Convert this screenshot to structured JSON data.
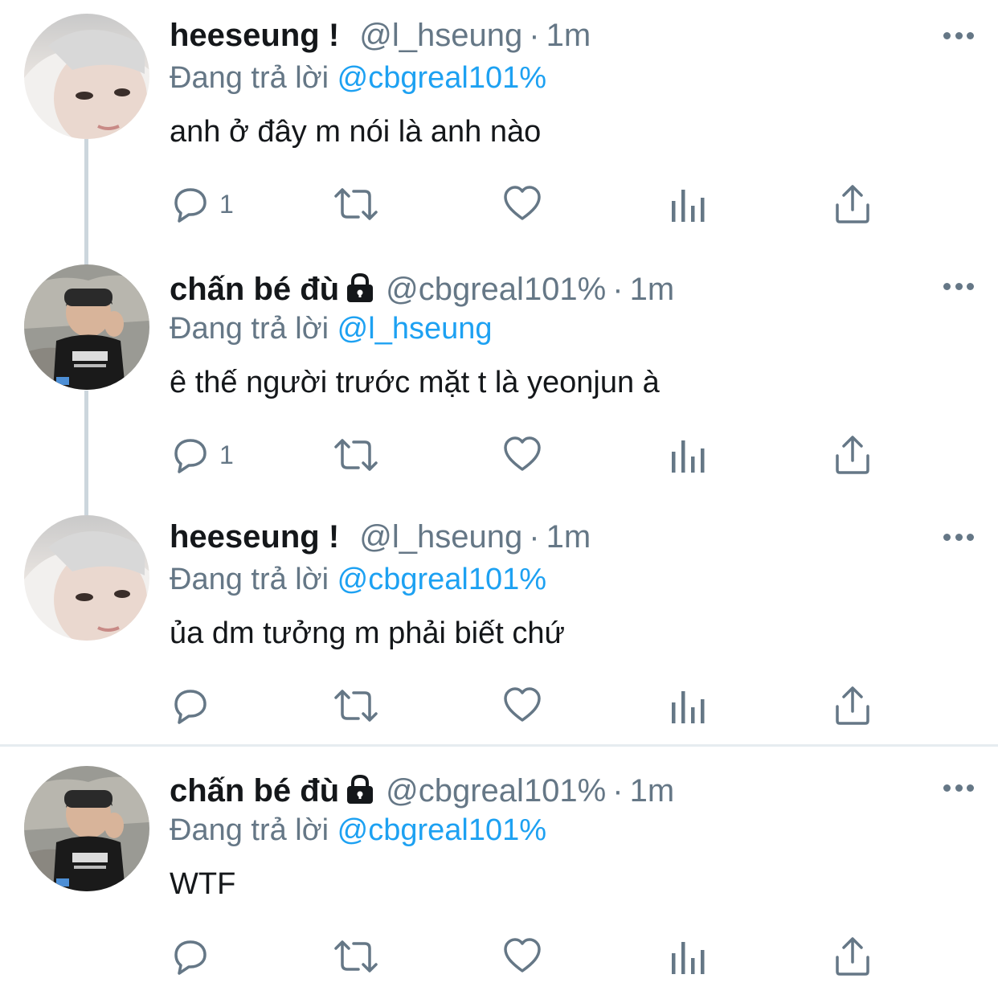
{
  "tweets": [
    {
      "name": "heeseung !",
      "handle": "@l_hseung",
      "sep": "·",
      "time": "1m",
      "reply_prefix": "Đang trả lời",
      "reply_to": "@cbgreal101%",
      "text": "anh ở đây m nói là anh nào",
      "reply_count": "1",
      "locked": false
    },
    {
      "name": "chấn bé đù",
      "handle": "@cbgreal101%",
      "sep": "·",
      "time": "1m",
      "reply_prefix": "Đang trả lời",
      "reply_to": "@l_hseung",
      "text": "ê thế người trước mặt t là yeonjun à",
      "reply_count": "1",
      "locked": true
    },
    {
      "name": "heeseung !",
      "handle": "@l_hseung",
      "sep": "·",
      "time": "1m",
      "reply_prefix": "Đang trả lời",
      "reply_to": "@cbgreal101%",
      "text": "ủa dm tưởng m phải biết chứ",
      "reply_count": "",
      "locked": false
    },
    {
      "name": "chấn bé đù",
      "handle": "@cbgreal101%",
      "sep": "·",
      "time": "1m",
      "reply_prefix": "Đang trả lời",
      "reply_to": "@cbgreal101%",
      "text": "WTF",
      "reply_count": "",
      "locked": true
    }
  ],
  "colors": {
    "text": "#14171a",
    "secondary": "#657786",
    "link": "#1da1f2",
    "thread_line": "#ccd6dd",
    "divider": "#e6ecf0"
  },
  "icons": {
    "lock": "lock-icon",
    "more": "more-options-icon",
    "reply": "reply-icon",
    "retweet": "retweet-icon",
    "like": "heart-icon",
    "analytics": "analytics-icon",
    "share": "share-icon"
  }
}
